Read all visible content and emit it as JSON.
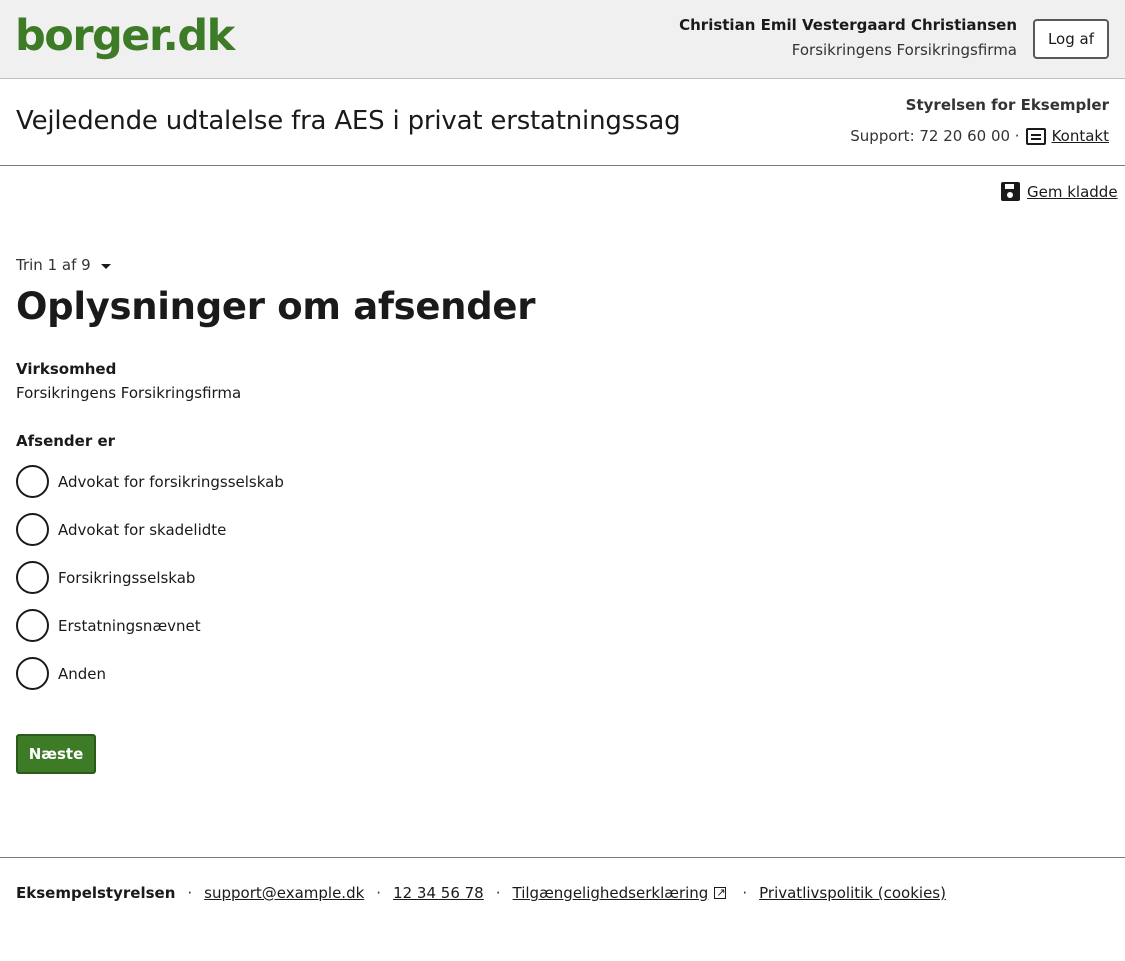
{
  "header": {
    "logo": "borger.dk",
    "user_name": "Christian Emil Vestergaard Christiansen",
    "user_org": "Forsikringens Forsikringsfirma",
    "logout_label": "Log af"
  },
  "titlebar": {
    "title": "Vejledende udtalelse fra AES i privat erstatningssag",
    "agency": "Styrelsen for Eksempler",
    "support_text": "Support: 72 20 60 00 ·",
    "contact_label": "Kontakt"
  },
  "toolbar": {
    "save_draft_label": "Gem kladde"
  },
  "step": {
    "label": "Trin 1 af 9"
  },
  "form": {
    "section_title": "Oplysninger om afsender",
    "company_label": "Virksomhed",
    "company_value": "Forsikringens Forsikringsfirma",
    "sender_label": "Afsender er",
    "options": [
      "Advokat for forsikringsselskab",
      "Advokat for skadelidte",
      "Forsikringsselskab",
      "Erstatningsnævnet",
      "Anden"
    ],
    "next_label": "Næste"
  },
  "footer": {
    "org": "Eksempelstyrelsen",
    "email": "support@example.dk",
    "phone": "12 34 56 78",
    "accessibility": "Tilgængelighedserklæring",
    "privacy": "Privatlivspolitik (cookies)"
  },
  "colors": {
    "brand_green": "#3d7b26",
    "header_bg": "#f0f0f0"
  }
}
